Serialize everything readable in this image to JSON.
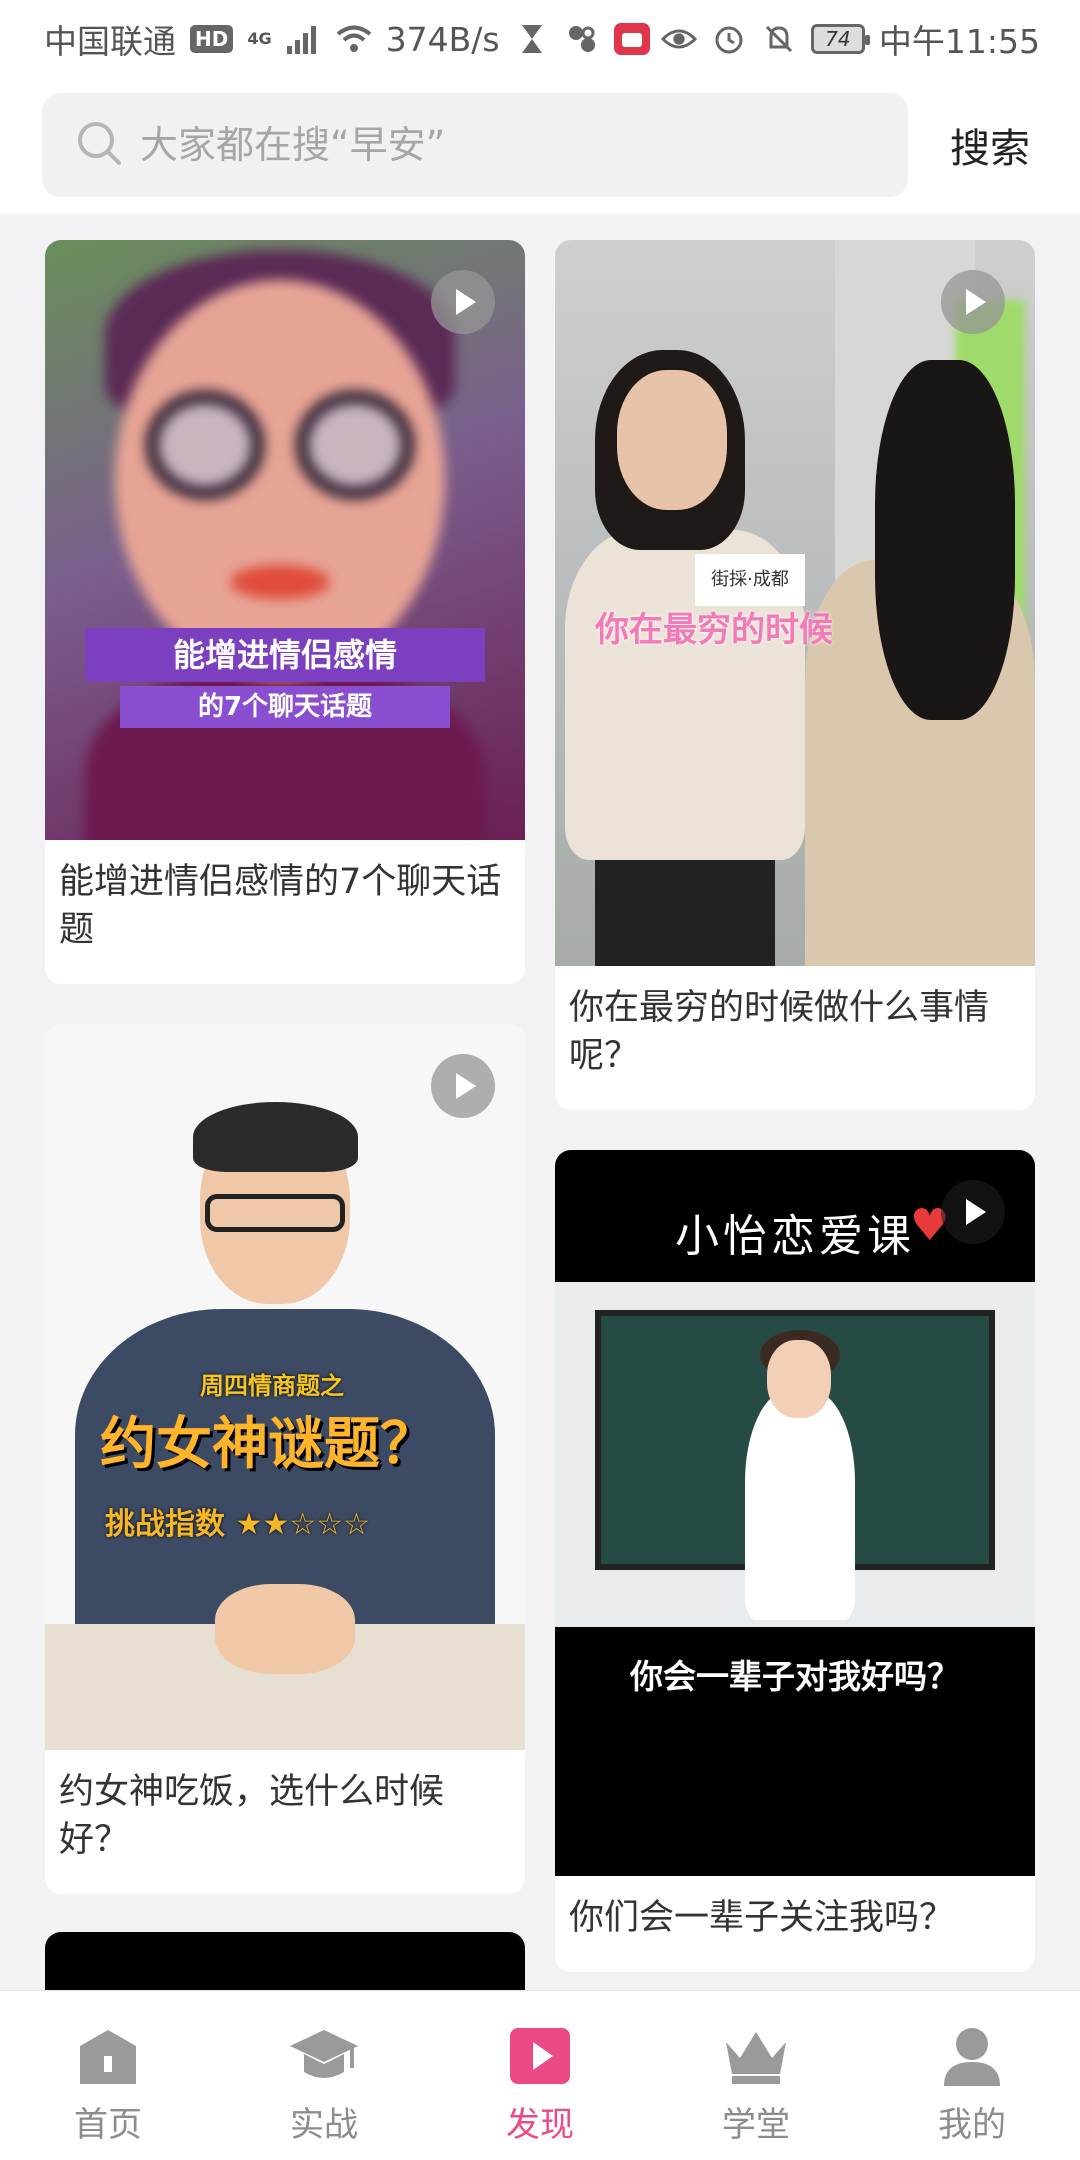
{
  "status_bar": {
    "carrier": "中国联通",
    "hd_badge": "HD",
    "network": "4G",
    "speed": "374B/s",
    "battery": "74",
    "time": "中午11:55"
  },
  "search": {
    "placeholder": "大家都在搜“早安”",
    "button_label": "搜索"
  },
  "feed": {
    "items": [
      {
        "title": "能增进情侣感情的7个聊天话题",
        "overlay_line1": "能增进情侣感情",
        "overlay_line2": "的7个聊天话题"
      },
      {
        "title": "你在最穷的时候做什么事情呢？",
        "overlay_line1": "你在最穷的时候",
        "sign_text": "街採·成都"
      },
      {
        "title": "约女神吃饭，选什么时候好？",
        "overlay_line1": "周四情商题之",
        "overlay_line2": "约女神谜题？",
        "overlay_line3": "挑战指数 ★★☆☆☆"
      },
      {
        "title": "你们会一辈子关注我吗？",
        "overlay_line1": "小怡恋爱课",
        "overlay_line2": "你会一辈子对我好吗？"
      }
    ]
  },
  "bottom_nav": {
    "items": [
      {
        "label": "首页",
        "icon": "home-icon"
      },
      {
        "label": "实战",
        "icon": "graduation-cap-icon"
      },
      {
        "label": "发现",
        "icon": "play-square-icon"
      },
      {
        "label": "学堂",
        "icon": "crown-icon"
      },
      {
        "label": "我的",
        "icon": "person-icon"
      }
    ],
    "active_index": 2
  },
  "colors": {
    "accent": "#ec4a87",
    "background": "#f2f2f4",
    "inactive": "#8c8c8c"
  }
}
